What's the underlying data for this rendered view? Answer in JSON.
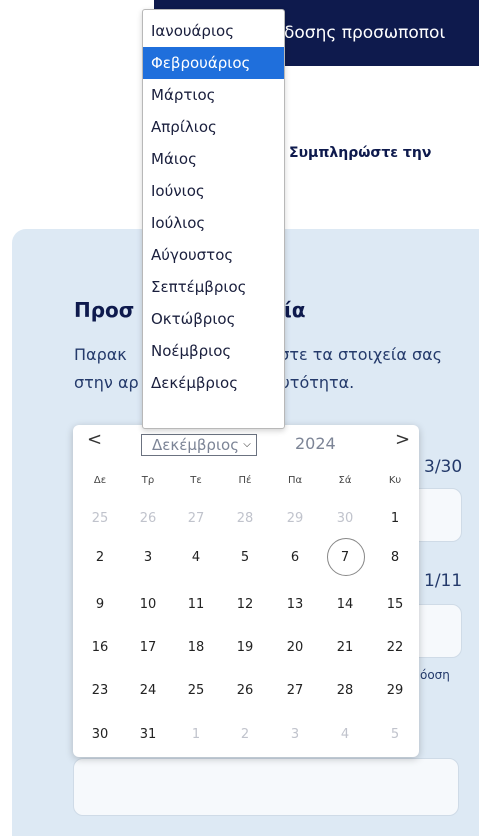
{
  "banner": {
    "text": "δοσης προσωποποι"
  },
  "intro": {
    "subheading": "Συμπληρώστε την"
  },
  "form": {
    "title_start": "Προσ",
    "title_end": "ία",
    "text_line1": "Παρακ",
    "text_line1_end": "ύστε τα στοιχεία σας",
    "text_line2": "στην αρ",
    "text_line2_end": "αυτότητα.",
    "side_label_1": "3/30",
    "side_label_2": "1/11",
    "side_small": "όοση"
  },
  "datepicker": {
    "prev_label": "<",
    "next_label": ">",
    "month_value": "Δεκέμβριος",
    "year_value": "2024",
    "weekdays": [
      "Δε",
      "Τρ",
      "Τε",
      "Πέ",
      "Πα",
      "Σά",
      "Κυ"
    ],
    "weeks": [
      [
        "25",
        "26",
        "27",
        "28",
        "29",
        "30",
        "1"
      ],
      [
        "2",
        "3",
        "4",
        "5",
        "6",
        "7",
        "8"
      ],
      [
        "9",
        "10",
        "11",
        "12",
        "13",
        "14",
        "15"
      ],
      [
        "16",
        "17",
        "18",
        "19",
        "20",
        "21",
        "22"
      ],
      [
        "23",
        "24",
        "25",
        "26",
        "27",
        "28",
        "29"
      ],
      [
        "30",
        "31",
        "1",
        "2",
        "3",
        "4",
        "5"
      ]
    ],
    "outside_month": [
      [
        true,
        true,
        true,
        true,
        true,
        true,
        false
      ],
      [
        false,
        false,
        false,
        false,
        false,
        false,
        false
      ],
      [
        false,
        false,
        false,
        false,
        false,
        false,
        false
      ],
      [
        false,
        false,
        false,
        false,
        false,
        false,
        false
      ],
      [
        false,
        false,
        false,
        false,
        false,
        false,
        false
      ],
      [
        false,
        false,
        true,
        true,
        true,
        true,
        true
      ]
    ],
    "today": "7"
  },
  "month_dropdown": {
    "options": [
      "Ιανουάριος",
      "Φεβρουάριος",
      "Μάρτιος",
      "Απρίλιος",
      "Μάιος",
      "Ιούνιος",
      "Ιούλιος",
      "Αύγουστος",
      "Σεπτέμβριος",
      "Οκτώβριος",
      "Νοέμβριος",
      "Δεκέμβριος"
    ],
    "highlighted": "Φεβρουάριος"
  },
  "colors": {
    "banner_bg": "#0e1a4d",
    "card_bg": "#dde9f4",
    "highlight": "#1f6fdc"
  }
}
